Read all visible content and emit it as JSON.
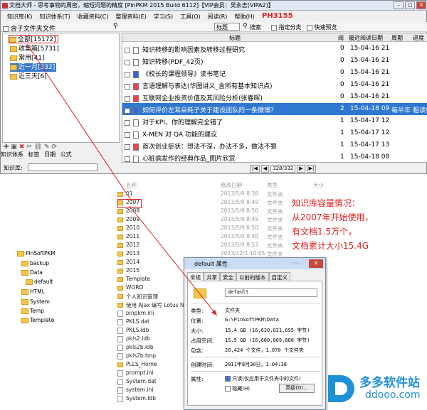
{
  "app": {
    "title": "文档大师 - 思考事物的周密，缩短问题的精度 [PinPKM 2015 Build 6112]【VIP会员：吴永志(VIPA2)】",
    "menus": [
      "知识库(K)",
      "知识体系(T)",
      "收藏资料(C)",
      "整理资料(E)",
      "学习(S)",
      "工具(O)",
      "阅读(R)",
      "帮助(H)"
    ],
    "red_label": "PH3155",
    "include_subfolders": "含子文件夹文件",
    "search_scope": "标题",
    "search_label": "搜索",
    "specify_category": "指定分类",
    "quick_preview": "快速预览",
    "tree": [
      {
        "label": "全部[15172]"
      },
      {
        "label": "收集箱[5731]"
      },
      {
        "label": "常用[41]"
      },
      {
        "label": "近一月[332]"
      },
      {
        "label": "近三天[6]"
      }
    ],
    "bottom_tabs": [
      "知识体系",
      "标签",
      "日期",
      "公式"
    ],
    "kb_label": "知识库:",
    "pager": "328/332",
    "columns": [
      "标题",
      "阅",
      "最近阅读日期",
      "周期",
      "进度"
    ],
    "rows": [
      {
        "title": "知识转移的影响因素及转移过程研究",
        "read": "0",
        "date": "15-04-16 21",
        "period": "",
        "progress": ""
      },
      {
        "title": "知识转移(PDF_42页)",
        "read": "0",
        "date": "15-04-16 21",
        "period": "",
        "progress": ""
      },
      {
        "title": "《校长的课程领导》读书笔记",
        "read": "0",
        "date": "15-04-16 21",
        "period": "",
        "progress": ""
      },
      {
        "title": "言语理解与表达(华图讲义_含所有基本知识点)",
        "read": "0",
        "date": "15-04-16 21",
        "period": "",
        "progress": ""
      },
      {
        "title": "互联网企业投资价值及其风险分析(张春晖)",
        "read": "0",
        "date": "15-04-16 21",
        "period": "",
        "progress": ""
      },
      {
        "title": "如何评价左耳朵耗子关于建设团队的一条微博？",
        "read": "2",
        "date": "15-04-18 09",
        "period": "每半年",
        "progress": "粗读中"
      },
      {
        "title": "对于KPI，你的理解完全错了",
        "read": "1",
        "date": "15-04-17 12",
        "period": "",
        "progress": ""
      },
      {
        "title": "X-MEN 对 QA 功能的建议",
        "read": "1",
        "date": "15-04-17 12",
        "period": "",
        "progress": ""
      },
      {
        "title": "首次创业症状：想法不深，办法不多，做法不狠",
        "read": "1",
        "date": "15-04-17 13",
        "period": "",
        "progress": ""
      },
      {
        "title": "心脏病发作的经典作品_图片欣赏",
        "read": "1",
        "date": "15-04-18 08",
        "period": "",
        "progress": ""
      }
    ]
  },
  "explorer": {
    "col_name": "名称",
    "col_date": "修改日期",
    "col_type": "类型",
    "col_size": "大小",
    "items": [
      {
        "n": "01",
        "d": "2013/5/9 8:38",
        "t": "文件夹"
      },
      {
        "n": "2007",
        "d": "2013/5/9 8:49",
        "t": "文件夹"
      },
      {
        "n": "2008",
        "d": "2013/5/9 8:50",
        "t": "文件夹"
      },
      {
        "n": "2009",
        "d": "2013/5/9 8:49",
        "t": "文件夹"
      },
      {
        "n": "2010",
        "d": "2013/5/9 8:50",
        "t": "文件夹"
      },
      {
        "n": "2011",
        "d": "2013/5/9 8:50",
        "t": "文件夹"
      },
      {
        "n": "2012",
        "d": "2013/5/9 8:53",
        "t": "文件夹"
      },
      {
        "n": "2013",
        "d": "2013/12/1 10:05",
        "t": "文件夹"
      },
      {
        "n": "2014",
        "d": "",
        "t": ""
      },
      {
        "n": "2015",
        "d": "",
        "t": ""
      },
      {
        "n": "Template",
        "d": "",
        "t": ""
      },
      {
        "n": "WORD",
        "d": "",
        "t": ""
      },
      {
        "n": "个人知识管理",
        "d": "",
        "t": ""
      },
      {
        "n": "使用 Ajax 编写 Lotus Note",
        "d": "",
        "t": ""
      },
      {
        "n": "pinpkm.ini",
        "d": "",
        "t": ""
      },
      {
        "n": "PKLS.dat",
        "d": "",
        "t": ""
      },
      {
        "n": "PKLS.ldb",
        "d": "",
        "t": ""
      },
      {
        "n": "pkls2.ldb",
        "d": "",
        "t": ""
      },
      {
        "n": "pkls2b.ldb",
        "d": "",
        "t": ""
      },
      {
        "n": "pkls2b.tmp",
        "d": "",
        "t": ""
      },
      {
        "n": "PLLS_Home",
        "d": "",
        "t": ""
      },
      {
        "n": "prompt.ini",
        "d": "",
        "t": ""
      },
      {
        "n": "System.dat",
        "d": "",
        "t": ""
      },
      {
        "n": "system.ini",
        "d": "",
        "t": ""
      },
      {
        "n": "System.ldb",
        "d": "",
        "t": ""
      }
    ],
    "tree": [
      "PinSoftPKM",
      "backup",
      "Data",
      "default",
      "HTML",
      "System",
      "Temp",
      "Template"
    ]
  },
  "dialog": {
    "title": "default 属性",
    "tabs": [
      "常规",
      "共享",
      "安全",
      "以前的版本",
      "自定义"
    ],
    "name": "default",
    "type_label": "类型:",
    "type": "文件夹",
    "loc_label": "位置:",
    "loc": "G:\\PinSoftPKM\\Data",
    "size_label": "大小:",
    "size": "15.4 GB (16,630,021,695 字节)",
    "disk_label": "占用空间:",
    "disk": "15.5 GB (16,680,869,888 字节)",
    "contains_label": "包含:",
    "contains": "20,424 个文件，1,070 个文件夹",
    "created_label": "创建时间:",
    "created": "2011年8月30日，1:04:38",
    "attr_label": "属性:",
    "readonly": "只读(仅应用于文件夹中的文件)",
    "hidden": "隐藏(H)",
    "advanced": "高级(D)..."
  },
  "note": [
    "知识库容量情况：",
    "从2007年开始使用，",
    "有文档1.5万个，",
    "文档累计大小15.4G"
  ],
  "watermark": {
    "text": "多多软件站",
    "url": "ddooo.com"
  },
  "colors": {
    "note": "#e02020",
    "highlight": "#2f78d2",
    "accent": "#1e90d8"
  }
}
